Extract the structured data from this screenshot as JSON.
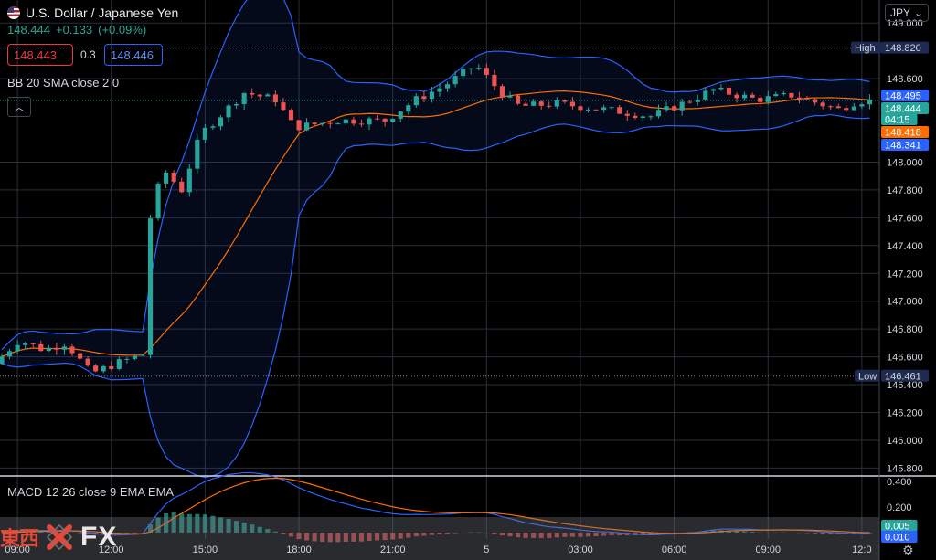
{
  "symbol": {
    "name": "U.S. Dollar / Japanese Yen",
    "last": "148.444",
    "change": "+0.133",
    "change_pct": "(+0.09%)",
    "sell_price": "148.443",
    "buy_price": "148.446",
    "spread": "0.3"
  },
  "currency_selector": {
    "value": "JPY"
  },
  "indicators": {
    "bb_label": "BB 20 SMA close 2 0",
    "macd_label": "MACD 12 26 close 9 EMA EMA"
  },
  "price_axis": {
    "ticks": [
      "149.000",
      "148.600",
      "148.000",
      "147.800",
      "147.600",
      "147.400",
      "147.200",
      "147.000",
      "146.800",
      "146.600",
      "146.400",
      "146.200",
      "146.000",
      "145.800"
    ],
    "macd_ticks": [
      "0.400",
      "0.200"
    ],
    "high_label": "High",
    "high_value": "148.820",
    "low_label": "Low",
    "low_value": "146.461",
    "badge_upper": "148.495",
    "badge_last": "148.444",
    "countdown": "04:15",
    "badge_basis": "148.418",
    "badge_lower": "148.341",
    "macd_badge": "0.005",
    "macd_badge2": "0.010"
  },
  "time_axis": {
    "ticks": [
      "09:00",
      "12:00",
      "15:00",
      "18:00",
      "21:00",
      "5",
      "03:00",
      "06:00",
      "09:00",
      "12:0"
    ]
  },
  "watermark": {
    "cjk": "東西",
    "fx": "FX"
  },
  "colors": {
    "up": "#26a69a",
    "down": "#ef5350",
    "band": "#2962ff",
    "basis": "#ff6d00",
    "macd_line": "#2962ff",
    "signal_line": "#ff6d00"
  },
  "chart_data": {
    "type": "candlestick",
    "interval_hours": [
      0,
      28
    ],
    "x_ticks": [
      "09:00",
      "12:00",
      "15:00",
      "18:00",
      "21:00",
      "5",
      "03:00",
      "06:00",
      "09:00",
      "12:0"
    ],
    "ylim": [
      145.75,
      149.1
    ],
    "anchors": [
      {
        "t": 0,
        "price": 146.55
      },
      {
        "t": 0.8,
        "price": 146.72
      },
      {
        "t": 1.6,
        "price": 146.65
      },
      {
        "t": 2.3,
        "price": 146.7
      },
      {
        "t": 3.1,
        "price": 146.48
      },
      {
        "t": 4.0,
        "price": 146.56
      },
      {
        "t": 4.8,
        "price": 146.62
      },
      {
        "t": 5.0,
        "price": 147.6
      },
      {
        "t": 5.4,
        "price": 147.95
      },
      {
        "t": 6.0,
        "price": 147.8
      },
      {
        "t": 6.6,
        "price": 148.2
      },
      {
        "t": 7.3,
        "price": 148.35
      },
      {
        "t": 8.0,
        "price": 148.5
      },
      {
        "t": 9.0,
        "price": 148.45
      },
      {
        "t": 9.6,
        "price": 148.25
      },
      {
        "t": 11.0,
        "price": 148.3
      },
      {
        "t": 12.5,
        "price": 148.3
      },
      {
        "t": 13.5,
        "price": 148.45
      },
      {
        "t": 14.4,
        "price": 148.55
      },
      {
        "t": 15.4,
        "price": 148.7
      },
      {
        "t": 16.2,
        "price": 148.5
      },
      {
        "t": 16.8,
        "price": 148.4
      },
      {
        "t": 18.0,
        "price": 148.42
      },
      {
        "t": 19.5,
        "price": 148.38
      },
      {
        "t": 21.0,
        "price": 148.33
      },
      {
        "t": 22.0,
        "price": 148.42
      },
      {
        "t": 23.0,
        "price": 148.52
      },
      {
        "t": 24.4,
        "price": 148.45
      },
      {
        "t": 25.5,
        "price": 148.48
      },
      {
        "t": 27.0,
        "price": 148.38
      },
      {
        "t": 27.6,
        "price": 148.44
      }
    ],
    "high": 148.82,
    "low": 146.461,
    "bollinger": {
      "period": 20,
      "stddev": 2,
      "upper_last": 148.495,
      "basis_last": 148.418,
      "lower_last": 148.341
    },
    "macd": {
      "fast": 12,
      "slow": 26,
      "signal": 9,
      "ylim": [
        -0.05,
        0.42
      ],
      "last": 0.005
    }
  }
}
